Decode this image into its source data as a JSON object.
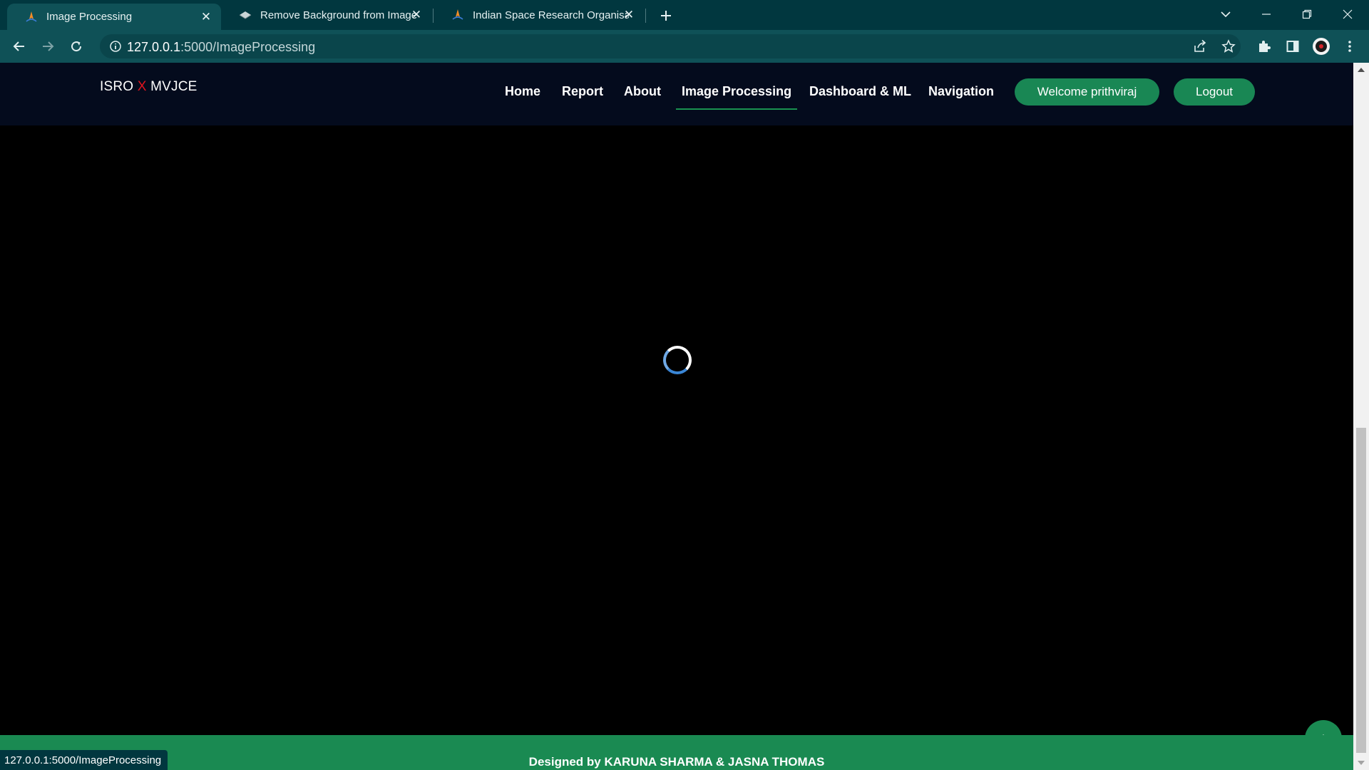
{
  "browser": {
    "tabs": [
      {
        "title": "Image Processing",
        "active": true
      },
      {
        "title": "Remove Background from Image",
        "active": false
      },
      {
        "title": "Indian Space Research Organisation",
        "active": false
      }
    ],
    "url_host": "127.0.0.1",
    "url_path": ":5000/ImageProcessing",
    "status_url": "127.0.0.1:5000/ImageProcessing"
  },
  "header": {
    "logo_left": "ISRO ",
    "logo_x": "X",
    "logo_right": " MVJCE",
    "nav": [
      "Home",
      "Report",
      "About",
      "Image Processing",
      "Dashboard & ML",
      "Navigation"
    ],
    "active_nav": "Image Processing",
    "welcome": "Welcome prithviraj",
    "logout": "Logout"
  },
  "footer": {
    "credit": "Designed by KARUNA SHARMA & JASNA THOMAS"
  },
  "colors": {
    "accent_green": "#198754",
    "header_bg": "#040b1d",
    "browser_frame": "#01373f",
    "logo_x": "#e0141e"
  }
}
